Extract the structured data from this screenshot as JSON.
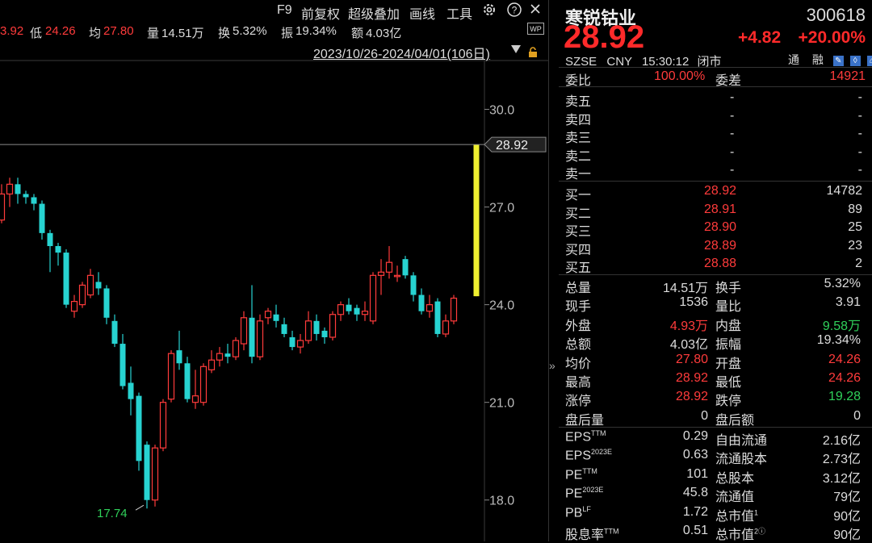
{
  "toolbar": {
    "f9": "F9",
    "adjust": "前复权",
    "overlay": "超级叠加",
    "draw": "画线",
    "tools": "工具",
    "gear_icon": "gear-icon",
    "help_icon": "help-icon",
    "close_icon": "close-icon",
    "more_icon": "chevron-right-icon"
  },
  "stats": {
    "partial_value": "3.92",
    "low_label": "低",
    "low_value": "24.26",
    "avg_label": "均",
    "avg_value": "27.80",
    "vol_label": "量",
    "vol_value": "14.51万",
    "turnover_label": "换",
    "turnover_value": "5.32%",
    "amp_label": "振",
    "amp_value": "19.34%",
    "amount_label": "额",
    "amount_value": "4.03亿",
    "wp": "WP"
  },
  "range": "2023/10/26-2024/04/01(106日)",
  "colors": {
    "up": "#ff3b3b",
    "down": "#27d3d1",
    "limit": "#f0f030",
    "green": "#2fd05a",
    "grid": "#3a3a3a"
  },
  "chart_data": {
    "type": "candlestick",
    "yticks": [
      "30.0",
      "27.0",
      "24.0",
      "21.0",
      "18.0"
    ],
    "ylim": [
      17.25,
      31.5
    ],
    "last_price_label": "28.92",
    "last_price": 28.92,
    "min_label": "17.74",
    "min_value": 17.74,
    "candles": [
      {
        "o": 26.2,
        "c": 26.6,
        "h": 26.8,
        "l": 26.0
      },
      {
        "o": 26.6,
        "c": 27.4,
        "h": 27.7,
        "l": 26.5
      },
      {
        "o": 27.4,
        "c": 27.7,
        "h": 27.9,
        "l": 27.0
      },
      {
        "o": 27.7,
        "c": 27.4,
        "h": 27.9,
        "l": 27.1
      },
      {
        "o": 27.4,
        "c": 27.3,
        "h": 27.5,
        "l": 27.1
      },
      {
        "o": 27.3,
        "c": 27.1,
        "h": 27.4,
        "l": 26.9
      },
      {
        "o": 27.1,
        "c": 26.2,
        "h": 27.2,
        "l": 26.0
      },
      {
        "o": 26.2,
        "c": 25.8,
        "h": 26.3,
        "l": 25.0
      },
      {
        "o": 25.8,
        "c": 25.6,
        "h": 25.9,
        "l": 25.2
      },
      {
        "o": 25.6,
        "c": 24.0,
        "h": 25.7,
        "l": 23.9
      },
      {
        "o": 23.8,
        "c": 24.1,
        "h": 24.3,
        "l": 23.6
      },
      {
        "o": 24.0,
        "c": 24.6,
        "h": 24.7,
        "l": 23.9
      },
      {
        "o": 24.3,
        "c": 24.9,
        "h": 25.1,
        "l": 24.2
      },
      {
        "o": 24.7,
        "c": 24.5,
        "h": 25.0,
        "l": 24.3
      },
      {
        "o": 24.5,
        "c": 23.6,
        "h": 24.6,
        "l": 23.4
      },
      {
        "o": 23.5,
        "c": 22.8,
        "h": 23.7,
        "l": 22.7
      },
      {
        "o": 22.8,
        "c": 21.5,
        "h": 23.1,
        "l": 21.4
      },
      {
        "o": 21.6,
        "c": 21.1,
        "h": 22.1,
        "l": 20.6
      },
      {
        "o": 21.2,
        "c": 19.2,
        "h": 21.3,
        "l": 18.9
      },
      {
        "o": 19.7,
        "c": 18.0,
        "h": 19.8,
        "l": 17.74
      },
      {
        "o": 18.0,
        "c": 19.6,
        "h": 19.7,
        "l": 17.8
      },
      {
        "o": 19.6,
        "c": 21.0,
        "h": 21.1,
        "l": 19.5
      },
      {
        "o": 21.1,
        "c": 22.5,
        "h": 22.6,
        "l": 21.0
      },
      {
        "o": 22.6,
        "c": 22.2,
        "h": 23.2,
        "l": 22.0
      },
      {
        "o": 22.2,
        "c": 21.1,
        "h": 22.4,
        "l": 21.0
      },
      {
        "o": 21.0,
        "c": 21.2,
        "h": 22.0,
        "l": 20.8
      },
      {
        "o": 21.0,
        "c": 22.1,
        "h": 22.2,
        "l": 20.9
      },
      {
        "o": 22.0,
        "c": 22.3,
        "h": 22.6,
        "l": 21.9
      },
      {
        "o": 22.3,
        "c": 22.5,
        "h": 22.7,
        "l": 22.1
      },
      {
        "o": 22.5,
        "c": 22.4,
        "h": 22.8,
        "l": 22.2
      },
      {
        "o": 22.4,
        "c": 22.9,
        "h": 23.0,
        "l": 22.3
      },
      {
        "o": 22.8,
        "c": 23.6,
        "h": 23.8,
        "l": 22.6
      },
      {
        "o": 23.6,
        "c": 22.4,
        "h": 24.6,
        "l": 22.2
      },
      {
        "o": 22.4,
        "c": 23.5,
        "h": 23.7,
        "l": 22.3
      },
      {
        "o": 23.6,
        "c": 23.8,
        "h": 23.9,
        "l": 23.4
      },
      {
        "o": 23.7,
        "c": 23.5,
        "h": 24.0,
        "l": 23.3
      },
      {
        "o": 23.4,
        "c": 23.1,
        "h": 23.6,
        "l": 23.0
      },
      {
        "o": 23.0,
        "c": 22.7,
        "h": 23.2,
        "l": 22.6
      },
      {
        "o": 22.7,
        "c": 22.9,
        "h": 23.1,
        "l": 22.5
      },
      {
        "o": 22.9,
        "c": 23.5,
        "h": 23.8,
        "l": 22.8
      },
      {
        "o": 23.5,
        "c": 23.1,
        "h": 23.7,
        "l": 22.9
      },
      {
        "o": 23.2,
        "c": 23.0,
        "h": 23.3,
        "l": 22.8
      },
      {
        "o": 23.0,
        "c": 23.7,
        "h": 23.8,
        "l": 22.9
      },
      {
        "o": 23.7,
        "c": 24.0,
        "h": 24.1,
        "l": 23.5
      },
      {
        "o": 24.0,
        "c": 23.8,
        "h": 24.2,
        "l": 23.7
      },
      {
        "o": 23.9,
        "c": 23.7,
        "h": 24.0,
        "l": 23.5
      },
      {
        "o": 23.7,
        "c": 23.8,
        "h": 24.1,
        "l": 23.5
      },
      {
        "o": 23.5,
        "c": 24.9,
        "h": 25.0,
        "l": 23.4
      },
      {
        "o": 24.9,
        "c": 25.0,
        "h": 25.4,
        "l": 24.3
      },
      {
        "o": 25.0,
        "c": 25.3,
        "h": 25.8,
        "l": 24.8
      },
      {
        "o": 24.9,
        "c": 24.9,
        "h": 25.2,
        "l": 24.7
      },
      {
        "o": 25.4,
        "c": 24.9,
        "h": 25.5,
        "l": 24.8
      },
      {
        "o": 24.9,
        "c": 24.3,
        "h": 25.0,
        "l": 24.1
      },
      {
        "o": 24.3,
        "c": 23.8,
        "h": 24.5,
        "l": 23.7
      },
      {
        "o": 23.8,
        "c": 24.0,
        "h": 24.3,
        "l": 23.6
      },
      {
        "o": 24.1,
        "c": 23.1,
        "h": 24.2,
        "l": 23.0
      },
      {
        "o": 23.1,
        "c": 23.5,
        "h": 23.7,
        "l": 23.0
      },
      {
        "o": 23.5,
        "c": 24.2,
        "h": 24.3,
        "l": 23.4
      },
      {
        "o": 24.26,
        "c": 28.92,
        "h": 28.92,
        "l": 24.26,
        "limit": true
      }
    ]
  },
  "quote": {
    "name": "寒锐钴业",
    "code": "300618",
    "price": "28.92",
    "change": "+4.82",
    "change_pct": "+20.00%",
    "market": "SZSE",
    "currency": "CNY",
    "time": "15:30:12",
    "status": "闭市",
    "tag1": "通",
    "tag2": "融"
  },
  "weibi": {
    "label": "委比",
    "value": "100.00%",
    "label2": "委差",
    "value2": "14921"
  },
  "asks": [
    {
      "label": "卖五",
      "price": "-",
      "vol": "-"
    },
    {
      "label": "卖四",
      "price": "-",
      "vol": "-"
    },
    {
      "label": "卖三",
      "price": "-",
      "vol": "-"
    },
    {
      "label": "卖二",
      "price": "-",
      "vol": "-"
    },
    {
      "label": "卖一",
      "price": "-",
      "vol": "-"
    }
  ],
  "bids": [
    {
      "label": "买一",
      "price": "28.92",
      "vol": "14782"
    },
    {
      "label": "买二",
      "price": "28.91",
      "vol": "89"
    },
    {
      "label": "买三",
      "price": "28.90",
      "vol": "25"
    },
    {
      "label": "买四",
      "price": "28.89",
      "vol": "23"
    },
    {
      "label": "买五",
      "price": "28.88",
      "vol": "2"
    }
  ],
  "details": [
    {
      "l1": "总量",
      "v1": "14.51万",
      "c1": "w",
      "l2": "换手",
      "v2": "5.32%",
      "c2": "w"
    },
    {
      "l1": "现手",
      "v1": "1536",
      "c1": "w",
      "l2": "量比",
      "v2": "3.91",
      "c2": "w"
    },
    {
      "l1": "外盘",
      "v1": "4.93万",
      "c1": "r",
      "l2": "内盘",
      "v2": "9.58万",
      "c2": "g"
    },
    {
      "l1": "总额",
      "v1": "4.03亿",
      "c1": "w",
      "l2": "振幅",
      "v2": "19.34%",
      "c2": "w"
    },
    {
      "l1": "均价",
      "v1": "27.80",
      "c1": "r",
      "l2": "开盘",
      "v2": "24.26",
      "c2": "r"
    },
    {
      "l1": "最高",
      "v1": "28.92",
      "c1": "r",
      "l2": "最低",
      "v2": "24.26",
      "c2": "r"
    },
    {
      "l1": "涨停",
      "v1": "28.92",
      "c1": "r",
      "l2": "跌停",
      "v2": "19.28",
      "c2": "g"
    },
    {
      "l1": "盘后量",
      "v1": "0",
      "c1": "w",
      "l2": "盘后额",
      "v2": "0",
      "c2": "w"
    }
  ],
  "fundamentals": [
    {
      "l1": "EPS",
      "s1": "TTM",
      "v1": "0.29",
      "l2": "自由流通",
      "s2": "",
      "v2": "2.16亿"
    },
    {
      "l1": "EPS",
      "s1": "2023E",
      "v1": "0.63",
      "l2": "流通股本",
      "s2": "",
      "v2": "2.73亿"
    },
    {
      "l1": "PE",
      "s1": "TTM",
      "v1": "101",
      "l2": "总股本",
      "s2": "",
      "v2": "3.12亿"
    },
    {
      "l1": "PE",
      "s1": "2023E",
      "v1": "45.8",
      "l2": "流通值",
      "s2": "",
      "v2": "79亿"
    },
    {
      "l1": "PB",
      "s1": "LF",
      "v1": "1.72",
      "l2": "总市值",
      "s2": "1",
      "v2": "90亿"
    },
    {
      "l1": "股息率",
      "s1": "TTM",
      "v1": "0.51",
      "l2": "总市值",
      "s2": "2ⓘ",
      "v2": "90亿"
    }
  ]
}
